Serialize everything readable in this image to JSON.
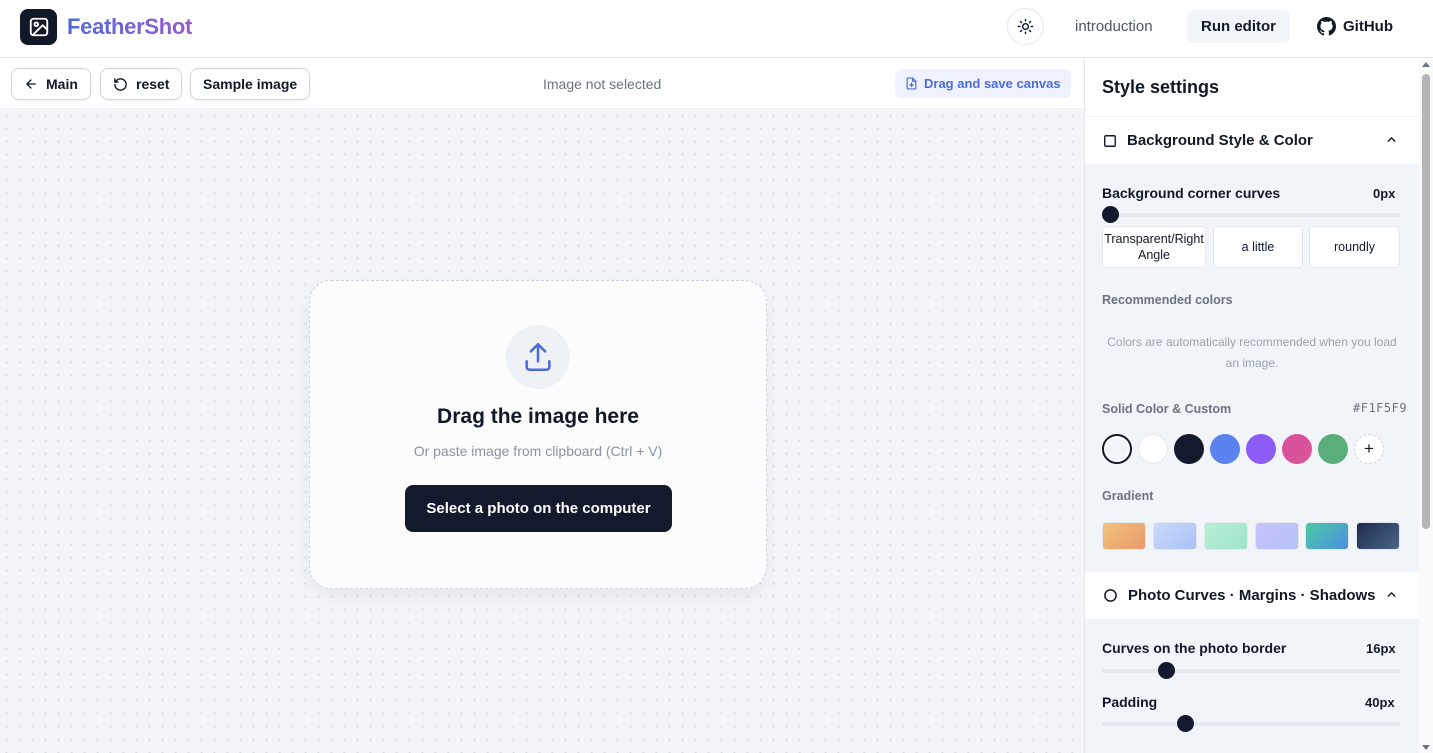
{
  "header": {
    "brand": "FeatherShot",
    "nav": {
      "introduction": "introduction",
      "run_editor": "Run editor",
      "github": "GitHub"
    }
  },
  "toolbar": {
    "main_label": "Main",
    "reset_label": "reset",
    "sample_label": "Sample image",
    "status": "Image not selected",
    "save_label": "Drag and save canvas"
  },
  "dropzone": {
    "title": "Drag the image here",
    "subtitle": "Or paste image from clipboard (Ctrl + V)",
    "button": "Select a photo on the computer"
  },
  "sidebar": {
    "title": "Style settings",
    "background_section": {
      "title": "Background Style & Color",
      "corner_label": "Background corner curves",
      "corner_value": "0px",
      "corner_level": 0,
      "presets": [
        "Transparent/Right Angle",
        "a little",
        "roundly"
      ],
      "recommended_label": "Recommended colors",
      "recommended_hint": "Colors are automatically recommended when you load an image.",
      "solid_label": "Solid Color & Custom",
      "solid_hex": "#F1F5F9",
      "swatches": [
        "#f1f5f9",
        "#ffffff",
        "#141a2e",
        "#5b83f0",
        "#8b5cf6",
        "#d9539b",
        "#5aae7b"
      ],
      "selected_swatch": 0,
      "add_swatch": "+",
      "gradient_label": "Gradient",
      "gradients": [
        [
          "#f2c27b",
          "#e99a6b"
        ],
        [
          "#c8dafc",
          "#a9c1f5"
        ],
        [
          "#b8f0d6",
          "#9fe3c6"
        ],
        [
          "#c9c2fb",
          "#b4c2f8"
        ],
        [
          "#4cc9a4",
          "#4a8fe0"
        ],
        [
          "#1f2d4f",
          "#4a6486"
        ]
      ]
    },
    "photo_section": {
      "title": "Photo Curves · Margins · Shadows",
      "curves_label": "Curves on the photo border",
      "curves_value": "16px",
      "padding_label": "Padding",
      "padding_value": "40px"
    }
  },
  "icons": {
    "logo": "image-icon",
    "theme": "sun-icon",
    "github": "github-icon",
    "back": "arrow-left-icon",
    "reset": "rotate-ccw-icon",
    "save": "file-download-icon",
    "upload": "upload-icon",
    "section1": "square-icon",
    "section2": "circle-icon",
    "chevron": "chevron-up-icon"
  }
}
